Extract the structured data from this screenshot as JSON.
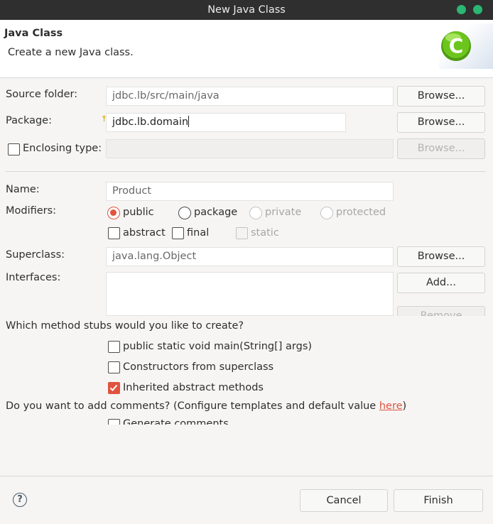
{
  "window": {
    "title": "New Java Class"
  },
  "header": {
    "title": "Java Class",
    "description": "Create a new Java class.",
    "logo_letter": "C"
  },
  "source_folder": {
    "label": "Source folder:",
    "value": "jdbc.lb/src/main/java",
    "browse": "Browse..."
  },
  "package": {
    "label": "Package:",
    "value": "jdbc.lb.domain",
    "browse": "Browse..."
  },
  "enclosing": {
    "label": "Enclosing type:",
    "value": "",
    "browse": "Browse..."
  },
  "name": {
    "label": "Name:",
    "value": "Product"
  },
  "modifiers": {
    "label": "Modifiers:",
    "public": "public",
    "package": "package",
    "private": "private",
    "protected": "protected",
    "abstract": "abstract",
    "final": "final",
    "static": "static"
  },
  "superclass": {
    "label": "Superclass:",
    "value": "java.lang.Object",
    "browse": "Browse..."
  },
  "interfaces": {
    "label": "Interfaces:",
    "add": "Add...",
    "remove": "Remove"
  },
  "stubs": {
    "question": "Which method stubs would you like to create?",
    "main": "public static void main(String[] args)",
    "constructors": "Constructors from superclass",
    "inherited": "Inherited abstract methods"
  },
  "comments": {
    "question": "Do you want to add comments? (Configure templates and default value ",
    "link": "here",
    "close": ")",
    "generate": "Generate comments"
  },
  "footer": {
    "help": "?",
    "cancel": "Cancel",
    "finish": "Finish"
  },
  "colors": {
    "accent": "#e0533f",
    "logo_green": "#6cc51d",
    "titlebar": "#2f2f2f"
  }
}
